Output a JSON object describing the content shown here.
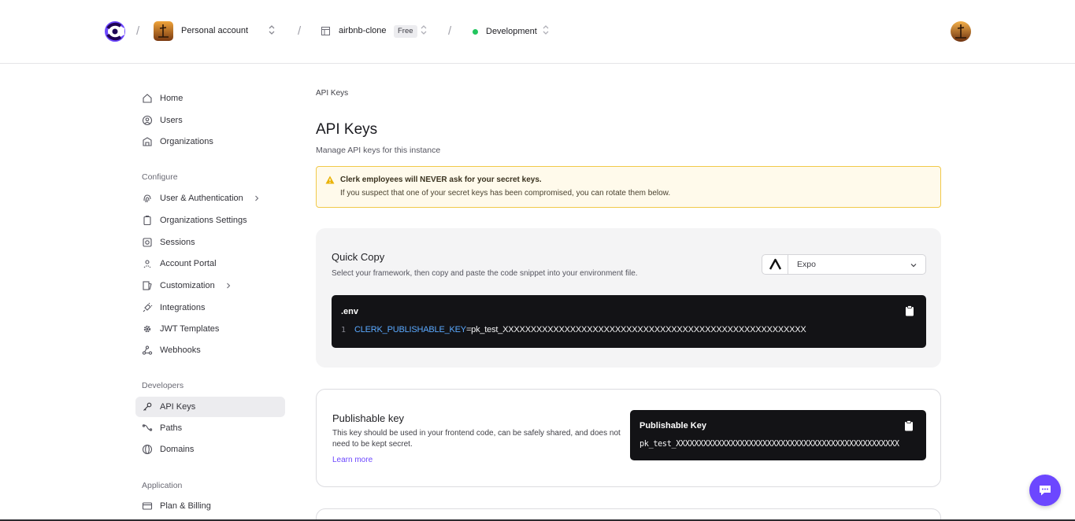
{
  "header": {
    "account_name": "Personal account",
    "app_name": "airbnb-clone",
    "plan_badge": "Free",
    "environment": "Development",
    "brand_color": "#6c47ff",
    "environment_status_color": "#22c55e"
  },
  "sidebar": {
    "top_items": [
      {
        "label": "Home",
        "icon": "home-icon"
      },
      {
        "label": "Users",
        "icon": "user-circle-icon"
      },
      {
        "label": "Organizations",
        "icon": "building-icon"
      }
    ],
    "configure_heading": "Configure",
    "configure_items": [
      {
        "label": "User & Authentication",
        "icon": "fingerprint-icon",
        "expandable": true
      },
      {
        "label": "Organizations Settings",
        "icon": "clipboard-icon"
      },
      {
        "label": "Sessions",
        "icon": "sessions-icon"
      },
      {
        "label": "Account Portal",
        "icon": "account-portal-icon"
      },
      {
        "label": "Customization",
        "icon": "customization-icon",
        "expandable": true
      },
      {
        "label": "Integrations",
        "icon": "plug-icon"
      },
      {
        "label": "JWT Templates",
        "icon": "gear-icon"
      },
      {
        "label": "Webhooks",
        "icon": "webhook-icon"
      }
    ],
    "developers_heading": "Developers",
    "developers_items": [
      {
        "label": "API Keys",
        "icon": "key-icon",
        "active": true
      },
      {
        "label": "Paths",
        "icon": "paths-icon"
      },
      {
        "label": "Domains",
        "icon": "globe-icon"
      }
    ],
    "application_heading": "Application",
    "application_items": [
      {
        "label": "Plan & Billing",
        "icon": "credit-card-icon"
      }
    ]
  },
  "main": {
    "breadcrumb": "API Keys",
    "title": "API Keys",
    "subtitle": "Manage API keys for this instance",
    "warning": {
      "title": "Clerk employees will NEVER ask for your secret keys.",
      "body": "If you suspect that one of your secret keys has been compromised, you can rotate them below.",
      "color": "#f1c94a"
    },
    "quick_copy": {
      "title": "Quick Copy",
      "subtitle": "Select your framework, then copy and paste the code snippet into your environment file.",
      "framework": "Expo",
      "file_name": ".env",
      "line_number": "1",
      "env_key": "CLERK_PUBLISHABLE_KEY",
      "env_value": "=pk_test_XXXXXXXXXXXXXXXXXXXXXXXXXXXXXXXXXXXXXXXXXXXXXXXXXXXXXX"
    },
    "publishable_key": {
      "title": "Publishable key",
      "description": "This key should be used in your frontend code, can be safely shared, and does not need to be kept secret.",
      "learn_more": "Learn more",
      "box_title": "Publishable Key",
      "value": "pk_test_XXXXXXXXXXXXXXXXXXXXXXXXXXXXXXXXXXXXXXXXXXXXXXXXX"
    }
  }
}
